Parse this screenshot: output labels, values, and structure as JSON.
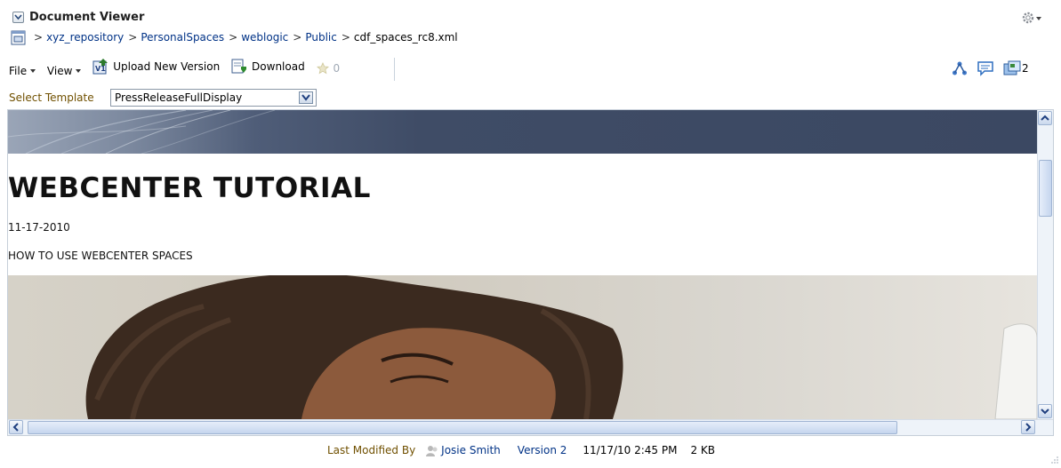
{
  "header": {
    "title": "Document Viewer",
    "icons": {
      "collapse": "collapse-chevron-icon",
      "settings": "gear-menu-icon"
    }
  },
  "breadcrumb": {
    "icon": "folder-tree-icon",
    "items": [
      "xyz_repository",
      "PersonalSpaces",
      "weblogic",
      "Public"
    ],
    "separator": ">",
    "current": "cdf_spaces_rc8.xml"
  },
  "toolbar": {
    "file_label": "File",
    "view_label": "View",
    "upload_label": "Upload New Version",
    "download_label": "Download",
    "star_count": "0",
    "right_icons": [
      "links-icon",
      "comments-icon",
      "recent-activity-icon"
    ],
    "activity_count": "2"
  },
  "template": {
    "label": "Select Template",
    "selected": "PressReleaseFullDisplay"
  },
  "document": {
    "title": "WEBCENTER TUTORIAL",
    "date": "11-17-2010",
    "subtitle": "HOW TO USE WEBCENTER SPACES"
  },
  "footer": {
    "last_modified_label": "Last Modified By",
    "user": "Josie Smith",
    "version": "Version 2",
    "date": "11/17/10 2:45 PM",
    "size": "2 KB"
  },
  "colors": {
    "link": "#003286",
    "label_brown": "#705000",
    "banner": "#3b4862"
  }
}
